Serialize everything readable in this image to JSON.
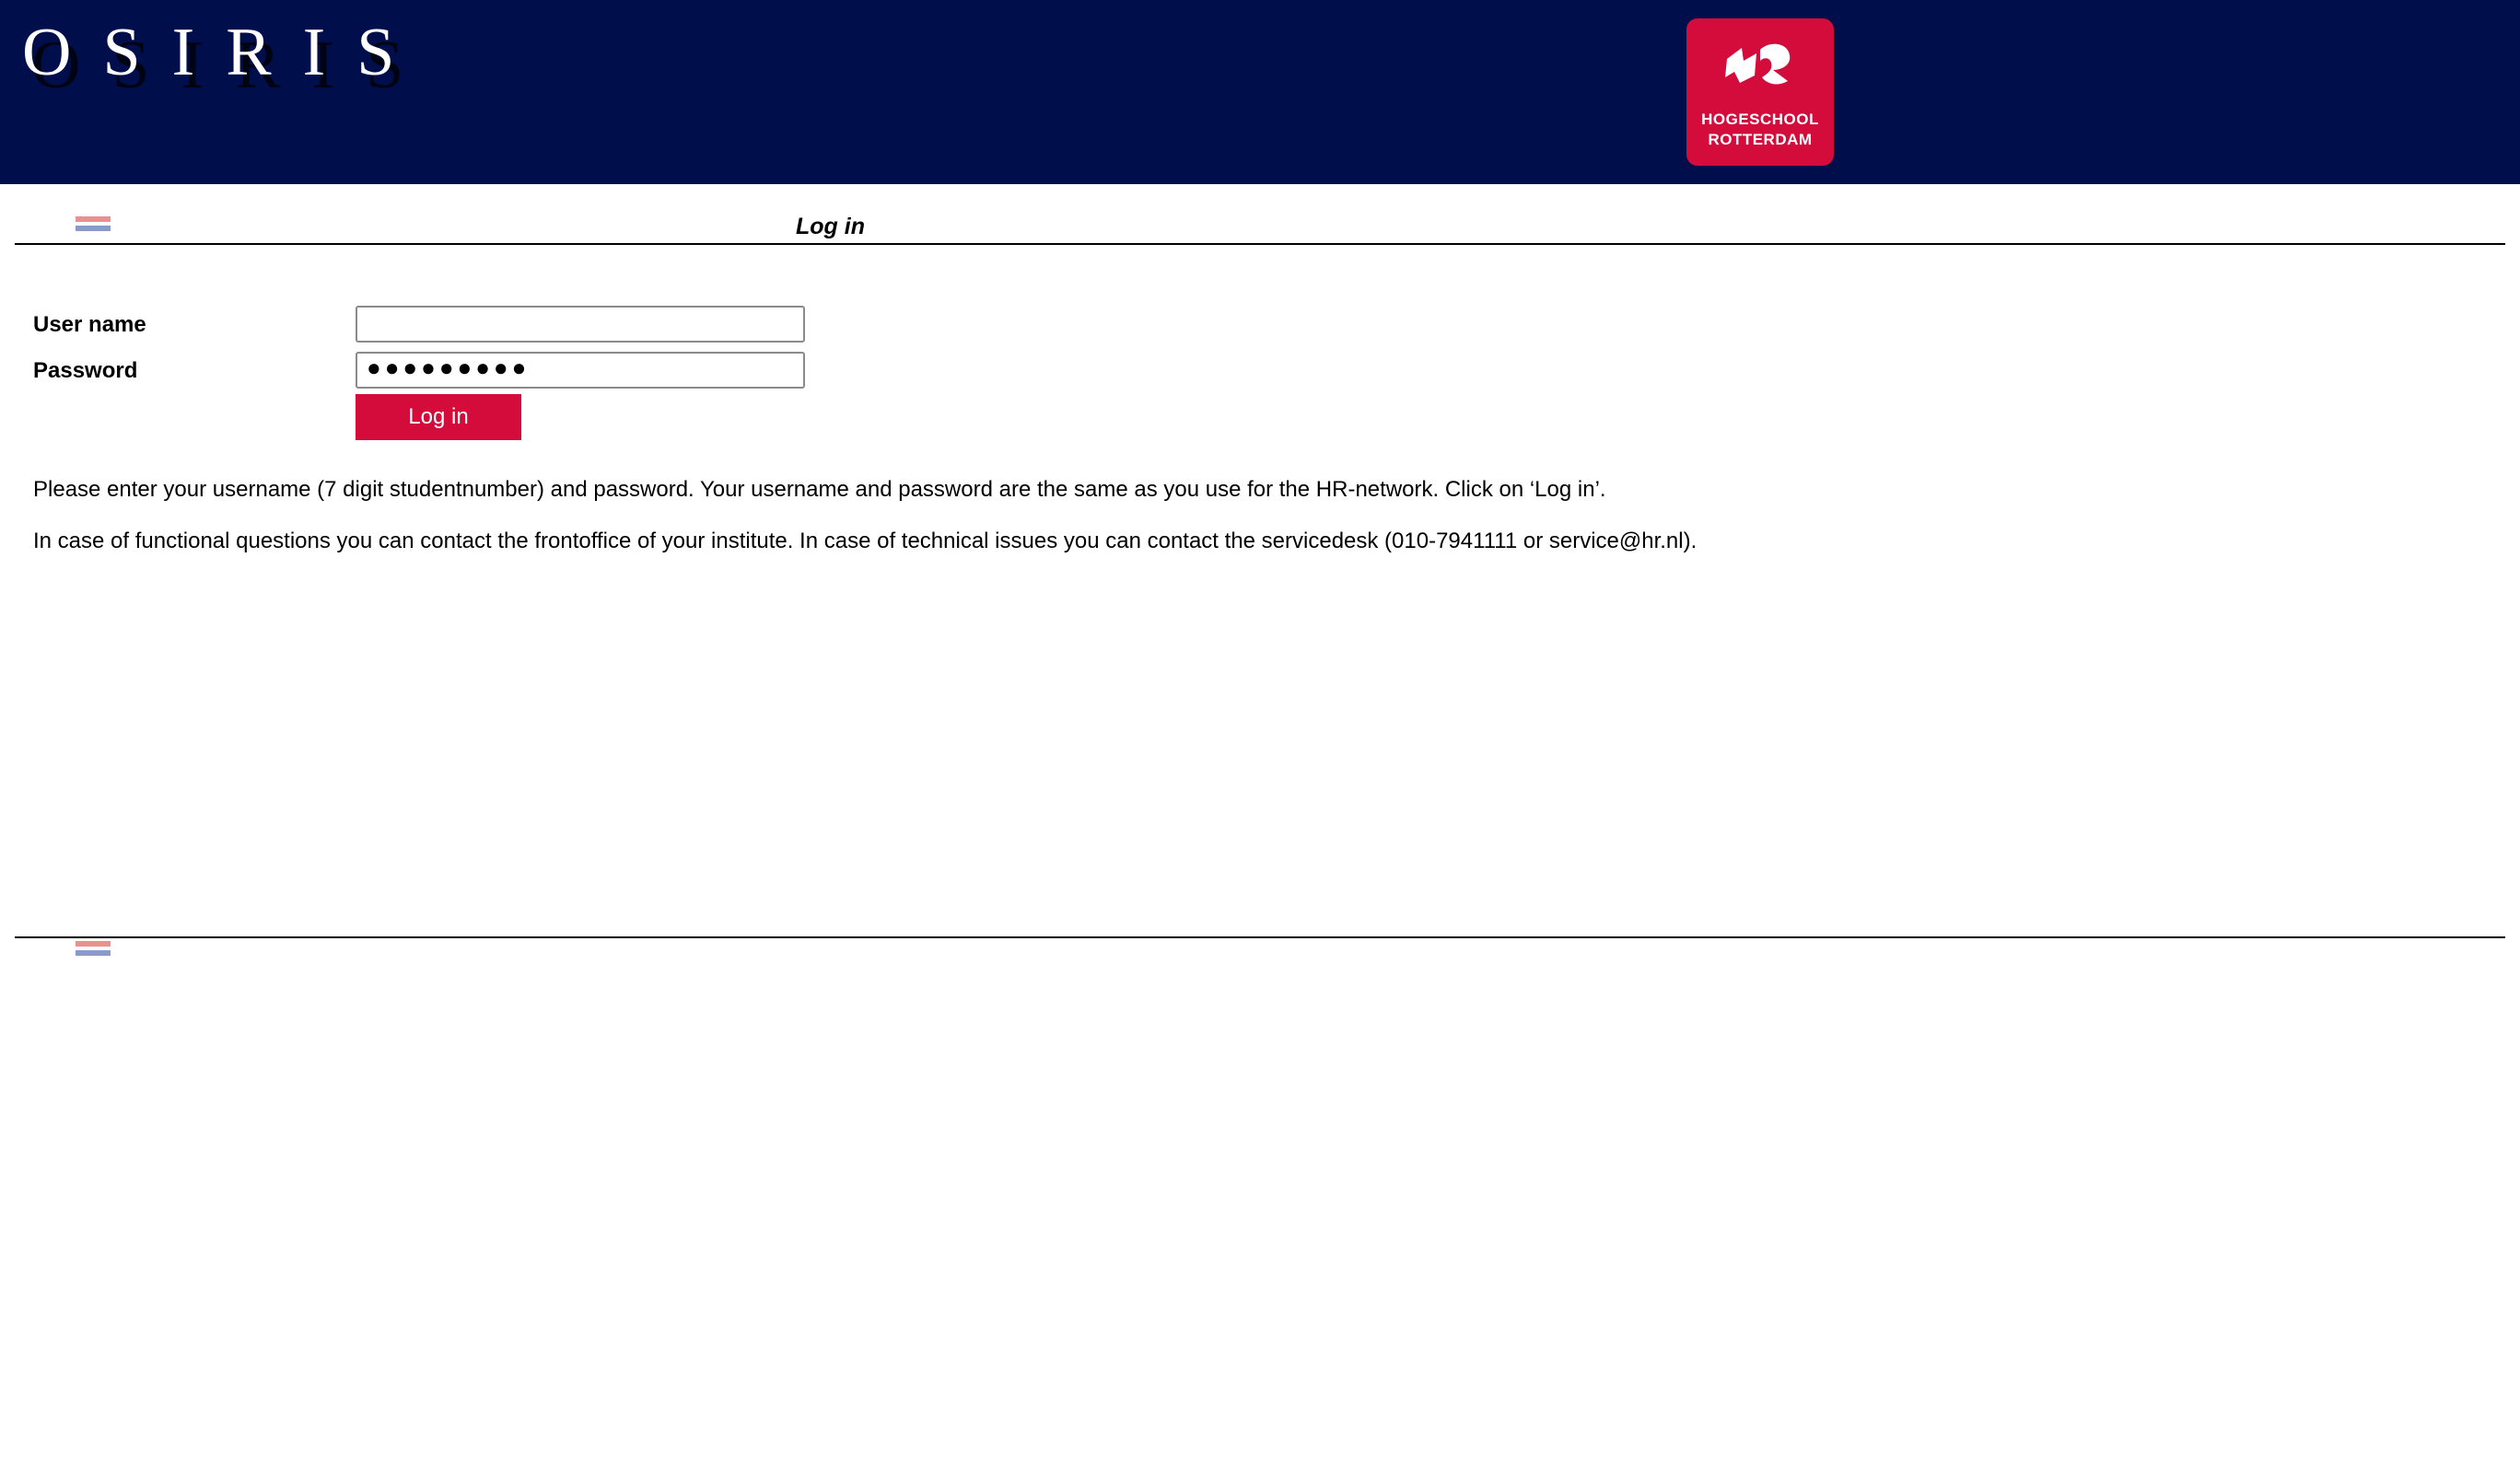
{
  "header": {
    "app_title": "OSIRIS",
    "logo": {
      "icon": "hogeschool-rotterdam-logo-icon",
      "line1": "HOGESCHOOL",
      "line2": "ROTTERDAM",
      "color": "#d40c3c"
    },
    "background_color": "#000e4b"
  },
  "language_flag_icon": "dutch-flag-icon",
  "page_title": "Log in",
  "form": {
    "username_label": "User name",
    "username_value": "",
    "password_label": "Password",
    "password_masked": "●●●●●●●●●",
    "submit_label": "Log in"
  },
  "info": {
    "line1": "Please enter your username (7 digit studentnumber) and password. Your username and password are the same as you use for the HR-network. Click on ‘Log in’.",
    "line2": "In case of functional questions you can contact the frontoffice of your institute. In case of technical issues you can contact the servicedesk (010-7941111 or service@hr.nl)."
  },
  "colors": {
    "accent": "#d40c3c",
    "header": "#000e4b"
  }
}
